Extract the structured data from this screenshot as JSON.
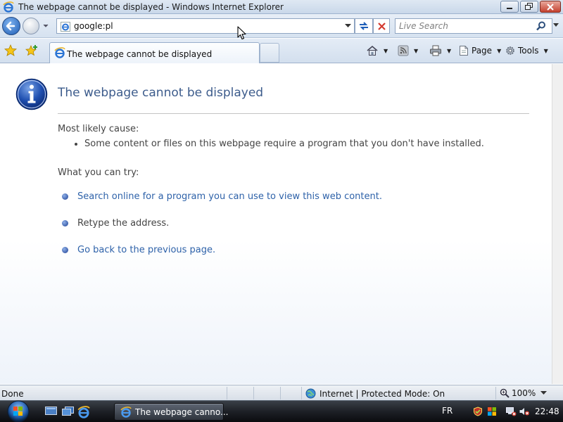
{
  "window": {
    "title": "The webpage cannot be displayed - Windows Internet Explorer"
  },
  "navbar": {
    "address": "google:pl",
    "search_placeholder": "Live Search"
  },
  "tabs": {
    "active_label": "The webpage cannot be displayed"
  },
  "commands": {
    "page_label": "Page",
    "tools_label": "Tools"
  },
  "content": {
    "title": "The webpage cannot be displayed",
    "cause_heading": "Most likely cause:",
    "cause_item": "Some content or files on this webpage require a program that you don't have installed.",
    "try_heading": "What you can try:",
    "try_items": [
      {
        "text": "Search online for a program you can use to view this web content.",
        "link": true
      },
      {
        "text": "Retype the address.",
        "link": false
      },
      {
        "text": "Go back to the previous page.",
        "link": true
      }
    ]
  },
  "statusbar": {
    "status": "Done",
    "zone": "Internet | Protected Mode: On",
    "zoom": "100%"
  },
  "taskbar": {
    "task_label": "The webpage canno...",
    "language": "FR",
    "time": "22:48"
  },
  "colors": {
    "title_blue": "#3d5c8c",
    "link_blue": "#2e62a9",
    "body_gray": "#444444"
  }
}
